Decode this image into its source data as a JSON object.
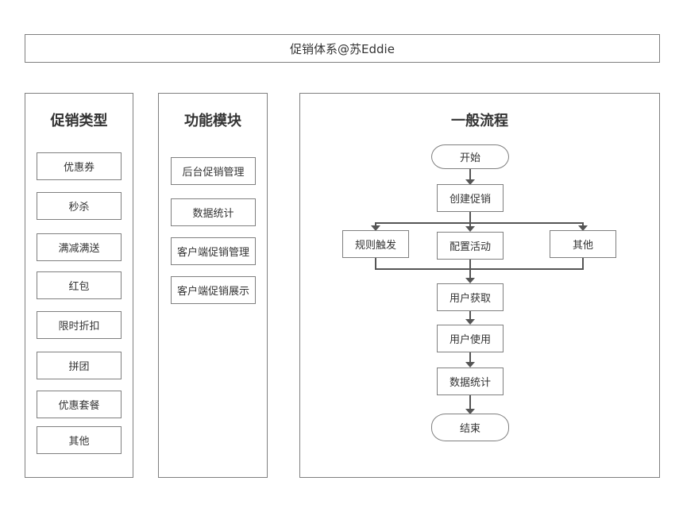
{
  "banner": {
    "title": "促销体系@苏Eddie"
  },
  "promo_types": {
    "title": "促销类型",
    "items": [
      "优惠券",
      "秒杀",
      "满减满送",
      "红包",
      "限时折扣",
      "拼团",
      "优惠套餐",
      "其他"
    ]
  },
  "modules": {
    "title": "功能模块",
    "items": [
      "后台促销管理",
      "数据统计",
      "客户端促销管理",
      "客户端促销展示"
    ]
  },
  "flow": {
    "title": "一般流程",
    "start": "开始",
    "create": "创建促销",
    "branches": [
      "规则触发",
      "配置活动",
      "其他"
    ],
    "acquire": "用户获取",
    "use": "用户使用",
    "stats": "数据统计",
    "end": "结束"
  },
  "colors": {
    "border": "#7f7f7f",
    "connector": "#555555",
    "text": "#333333"
  }
}
